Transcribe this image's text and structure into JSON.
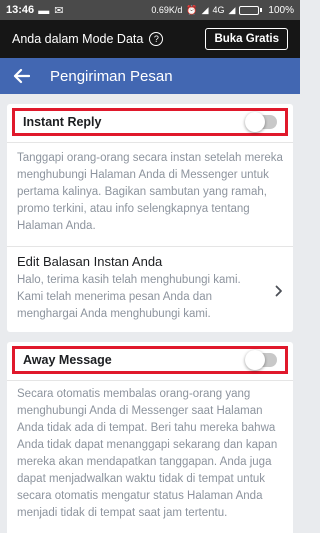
{
  "status_bar": {
    "time": "13:46",
    "speed": "0.69K/d",
    "network": "4G",
    "battery": "100%"
  },
  "data_mode": {
    "text": "Anda dalam Mode Data",
    "help": "?",
    "free_button": "Buka Gratis"
  },
  "app_bar": {
    "title": "Pengiriman Pesan"
  },
  "instant_reply": {
    "label": "Instant Reply",
    "enabled": false,
    "description": "Tanggapi orang-orang secara instan setelah mereka menghubungi Halaman Anda di Messenger untuk pertama kalinya. Bagikan sambutan yang ramah, promo terkini, atau info selengkapnya tentang Halaman Anda.",
    "edit_title": "Edit Balasan Instan Anda",
    "edit_message": "Halo, terima kasih telah menghubungi kami. Kami telah menerima pesan Anda dan menghargai Anda menghubungi kami."
  },
  "away_message": {
    "label": "Away Message",
    "enabled": false,
    "description": "Secara otomatis membalas orang-orang yang menghubungi Anda di Messenger saat Halaman Anda tidak ada di tempat. Beri tahu mereka bahwa Anda tidak dapat menanggapi sekarang dan kapan mereka akan mendapatkan tanggapan. Anda juga dapat menjadwalkan waktu tidak di tempat untuk secara otomatis mengatur status Halaman Anda menjadi tidak di tempat saat jam tertentu."
  },
  "colors": {
    "app_bar": "#4267b2",
    "highlight": "#e0182b"
  }
}
